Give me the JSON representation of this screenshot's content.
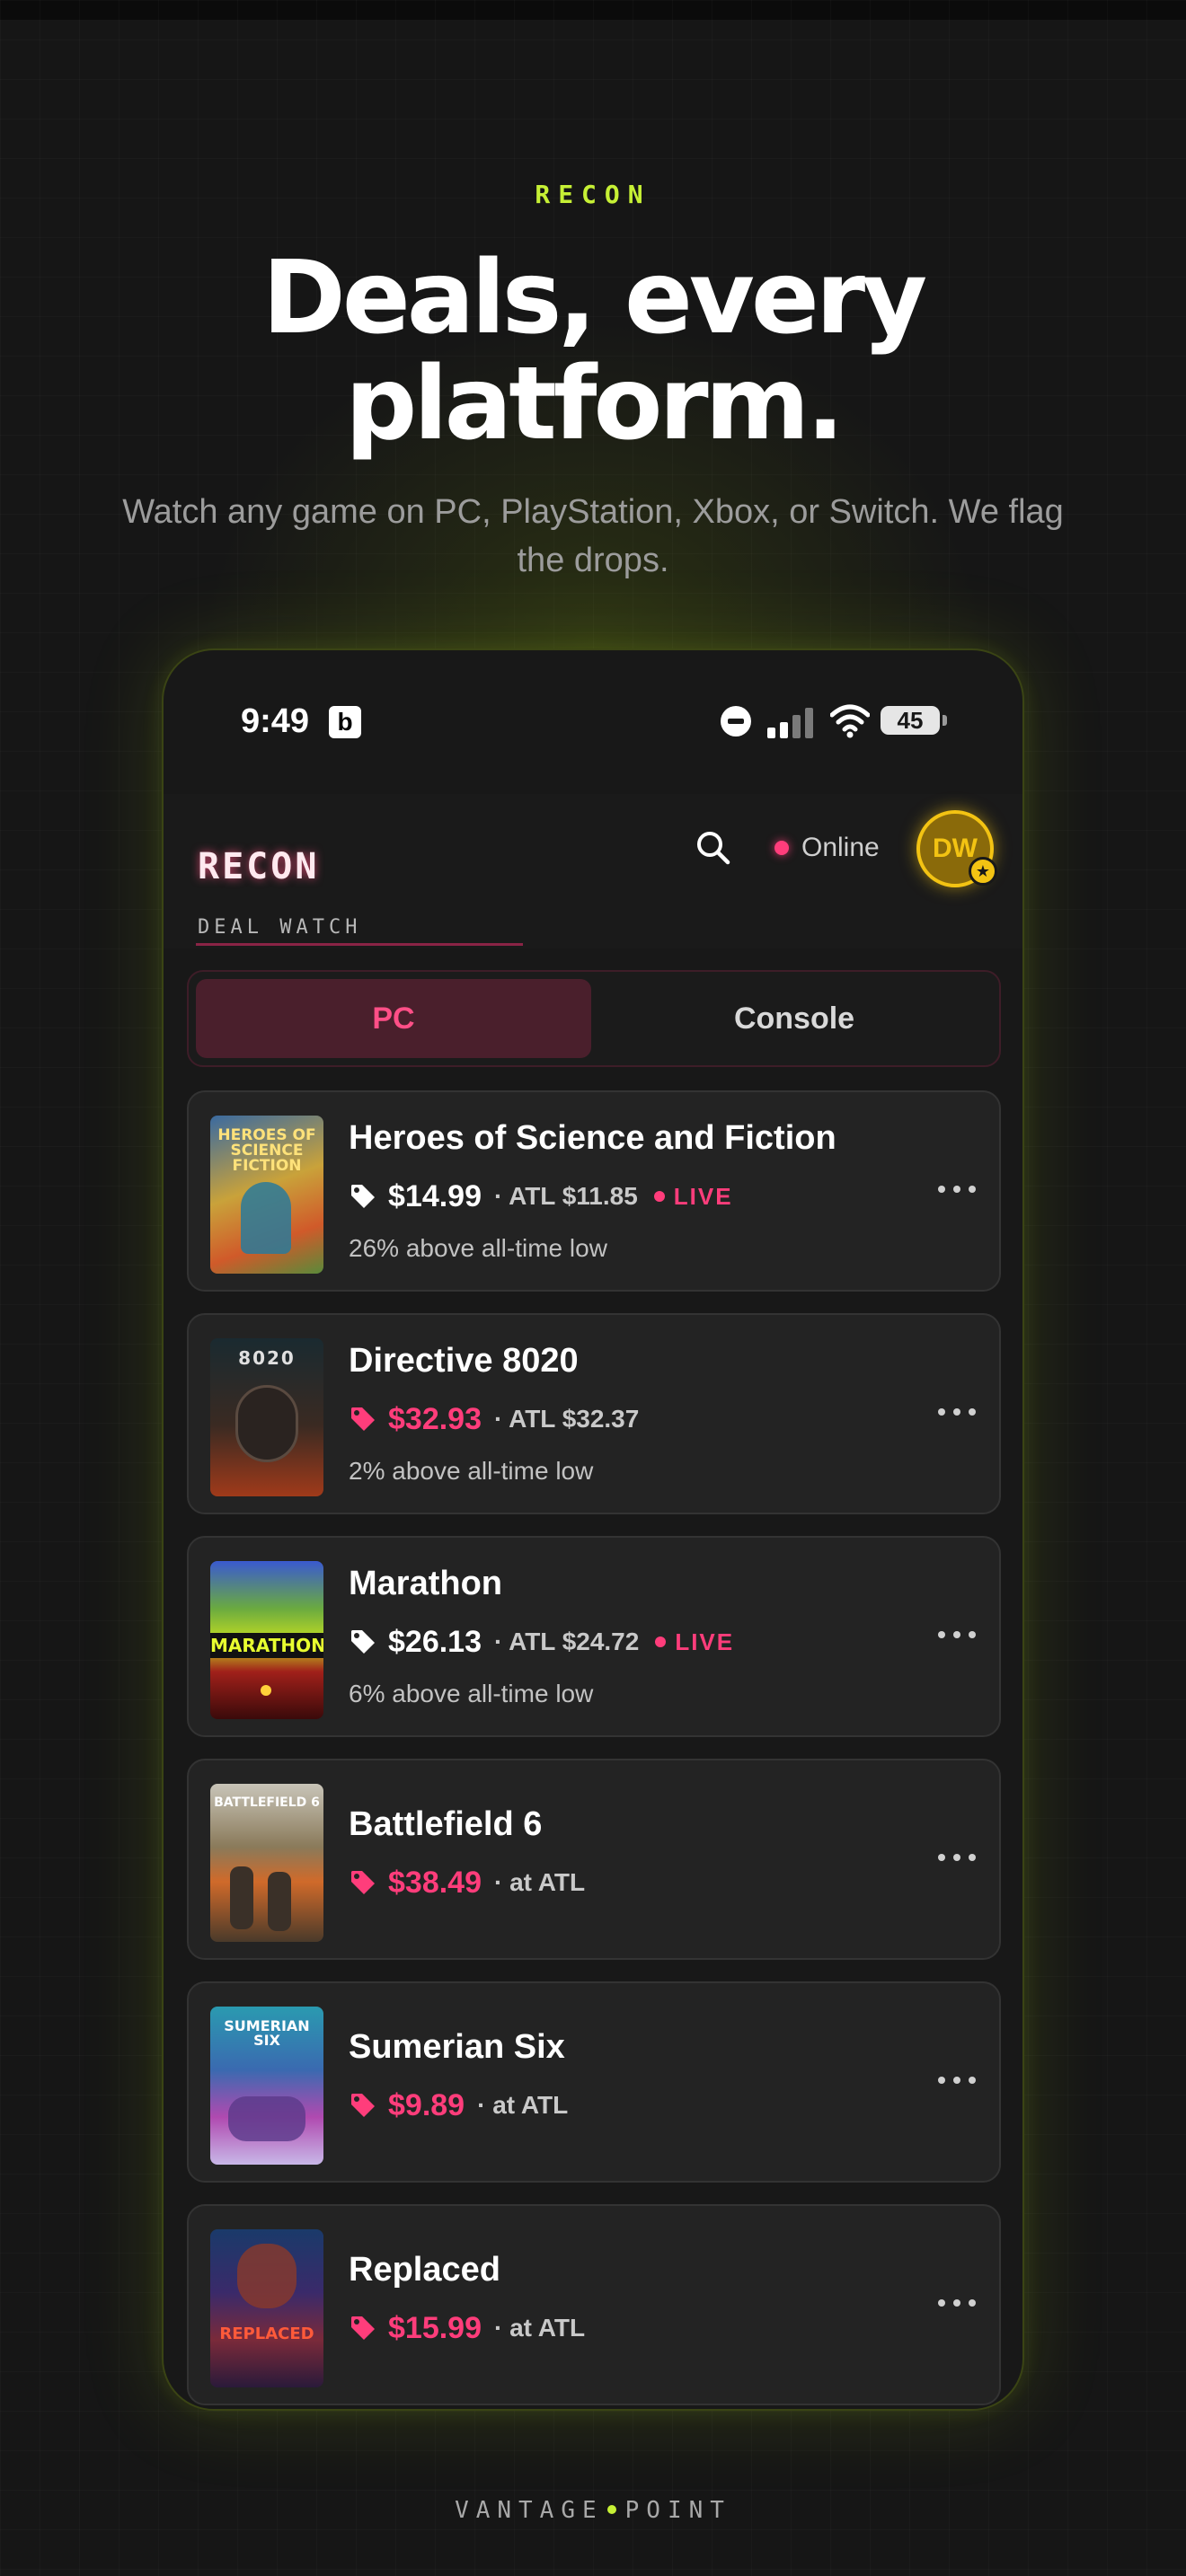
{
  "hero": {
    "eyebrow": "RECON",
    "headline_line1": "Deals, every",
    "headline_line2": "platform.",
    "subhead": "Watch any game on PC, PlayStation, Xbox, or Switch. We flag the drops."
  },
  "statusbar": {
    "time": "9:49",
    "app_badge": "b",
    "battery": "45"
  },
  "app": {
    "logo": "RECON",
    "tagline": "DEAL WATCH",
    "online_label": "Online",
    "avatar_initials": "DW",
    "tabs": [
      {
        "label": "PC",
        "active": true
      },
      {
        "label": "Console",
        "active": false
      }
    ]
  },
  "games": [
    {
      "title": "Heroes of Science and Fiction",
      "price": "$14.99",
      "atl": "· ATL $11.85",
      "live": "LIVE",
      "note": "26% above all-time low",
      "price_color": "#ffffff"
    },
    {
      "title": "Directive 8020",
      "price": "$32.93",
      "atl": "· ATL $32.37",
      "note": "2% above all-time low",
      "price_color": "#ff3d7b"
    },
    {
      "title": "Marathon",
      "price": "$26.13",
      "atl": "· ATL $24.72",
      "live": "LIVE",
      "note": "6% above all-time low",
      "price_color": "#ffffff"
    },
    {
      "title": "Battlefield 6",
      "price": "$38.49",
      "atl": "· at ATL",
      "price_color": "#ff3d7b"
    },
    {
      "title": "Sumerian Six",
      "price": "$9.89",
      "atl": "· at ATL",
      "price_color": "#ff3d7b"
    },
    {
      "title": "Replaced",
      "price": "$15.99",
      "atl": "· at ATL",
      "price_color": "#ff3d7b"
    }
  ],
  "covers": [
    {
      "art": "HEROES OF SCIENCE FICTION"
    },
    {
      "art": "8020"
    },
    {
      "art": "MARATHON"
    },
    {
      "art": "BATTLEFIELD 6"
    },
    {
      "art": "SUMERIAN SIX"
    },
    {
      "art": "REPLACED"
    }
  ],
  "footer": {
    "left": "VANTAGE",
    "right": "POINT"
  },
  "colors": {
    "accent_lime": "#c6f035",
    "accent_pink": "#ff3d7b",
    "avatar_gold": "#f3c313"
  }
}
